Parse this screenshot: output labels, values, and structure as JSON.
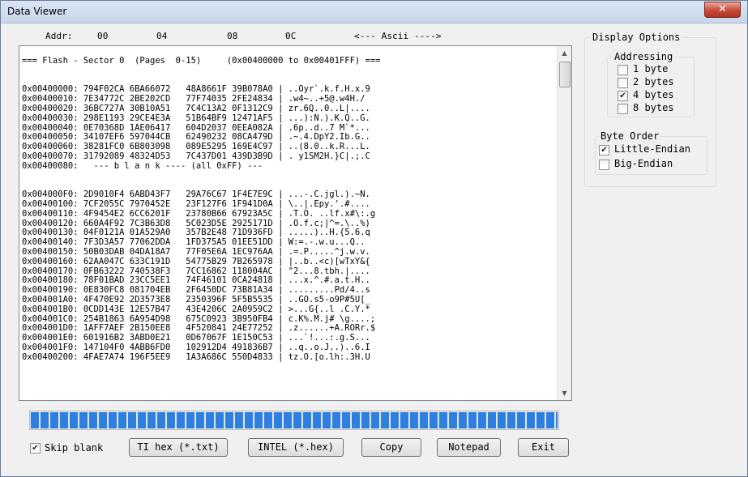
{
  "window": {
    "title": "Data Viewer",
    "close_glyph": "✕"
  },
  "header": {
    "addr": "Addr:",
    "col0": "00",
    "col1": "04",
    "col2": "08",
    "col3": "0C",
    "ascii": "<--- Ascii ---->"
  },
  "dump_lines": [
    "=== Flash - Sector 0  (Pages  0-15)     (0x00400000 to 0x00401FFF) ===",
    "",
    "",
    "0x00400000: 794F02CA 6BA66072   48A8661F 39B078A0 | ..Oyr`.k.f.H.x.9",
    "0x00400010: 7E34772C 2BE202CD   77F74035 2FE24834 | .w4~..+5@.w4H./",
    "0x00400020: 36BC727A 30B10A51   7C4C13A2 0F1312C9 | zr.6Q..0..L|....",
    "0x00400030: 298E1193 29CE4E3A   51B64BF9 12471AF5 | ...):N.).K.Q..G.",
    "0x00400040: 0E70368D 1AE06417   604D2037 0EEA082A | .6p..d..7 M`*...",
    "0x00400050: 34107EF6 597044CB   62490232 08CA479D | .~.4.DpY2.Ib.G..",
    "0x00400060: 38281FC0 6B803098   089E5295 169E4C97 | ..(8.0..k.R...L.",
    "0x00400070: 31792089 48324D53   7C437D01 439D3B9D | . y1SM2H.}C|.;.C",
    "0x00400080:   --- b l a n k ---- (all 0xFF) ---",
    "",
    "",
    "0x004000F0: 2D9010F4 6ABD43F7   29A76C67 1F4E7E9C | ...-.C.jgl.).~N.",
    "0x00400100: 7CF2055C 7970452E   23F127F6 1F941D0A | \\..|.Epy.'.#....",
    "0x00400110: 4F9454E2 6CC6201F   23780B66 67923A5C | .T.O. ..lf.x#\\:.g",
    "0x00400120: 660A4F92 7C3B63D8   5C023D5E 2925171D | .O.f.c;|^=.\\..%)",
    "0x00400130: 04F0121A 01A529A0   357B2E48 71D936FD | .....)..H.{5.6.q",
    "0x00400140: 7F3D3A57 77062DDA   1FD375A5 01EE51DD | W:=.-.w.u...Q..",
    "0x00400150: 50B03DAB 04DA18A7   77F05E6A 1EC976AA | .=.P.....^j.w.v.",
    "0x00400160: 62AA047C 633C191D   54775B29 7B265978 | |..b..<c)[wTxY&{",
    "0x00400170: 0FB63222 740538F3   7CC16862 118004AC | \"2...8.tbh.|....",
    "0x00400180: 78F01BAD 23CC5EE1   74F46101 0CA24818 | ...x.^.#.a.t.H..",
    "0x00400190: 0E830FC8 081704EB   2F6450DC 73B81A34 | .........Pd/4..s",
    "0x004001A0: 4F470E92 2D3573E8   2350396F 5F5B5535 | ..GO.s5-o9P#5U[_",
    "0x004001B0: 0CDD143E 12E57B47   43E4206C 2A0959C2 | >...G{..l .C.Y.*",
    "0x004001C0: 254B1863 6A954D98   675C0923 3B950FB4 | c.K%.M.j# \\g....;",
    "0x004001D0: 1AFF7AEF 2B150EE8   4F520841 24E77252 | .z......+A.RORr.$",
    "0x004001E0: 601916B2 3ABD0E21   0D67067F 1E150C53 | ...`!...:.g.S...",
    "0x004001F0: 147104F0 4ABB6FD0   102912D4 491836B7 | ..q..o.J..)..6.I",
    "0x00400200: 4FAE7A74 196F5EE9   1A3A686C 550D4833 | tz.O.[o.lh:.3H.U"
  ],
  "progress": {
    "fraction": 1.0
  },
  "skip_blank": {
    "label": "Skip blank",
    "checked": true
  },
  "buttons": {
    "ti_hex": "TI hex (*.txt)",
    "intel_hex": "INTEL (*.hex)",
    "copy": "Copy",
    "notepad": "Notepad",
    "exit": "Exit"
  },
  "display_options": {
    "title": "Display Options",
    "addressing": {
      "title": "Addressing",
      "options": [
        {
          "label": "1 byte",
          "checked": false
        },
        {
          "label": "2 bytes",
          "checked": false
        },
        {
          "label": "4 bytes",
          "checked": true
        },
        {
          "label": "8 bytes",
          "checked": false
        }
      ]
    },
    "byte_order": {
      "title": "Byte Order",
      "options": [
        {
          "label": "Little-Endian",
          "checked": true
        },
        {
          "label": "Big-Endian",
          "checked": false
        }
      ]
    }
  },
  "check_glyph": "✔"
}
